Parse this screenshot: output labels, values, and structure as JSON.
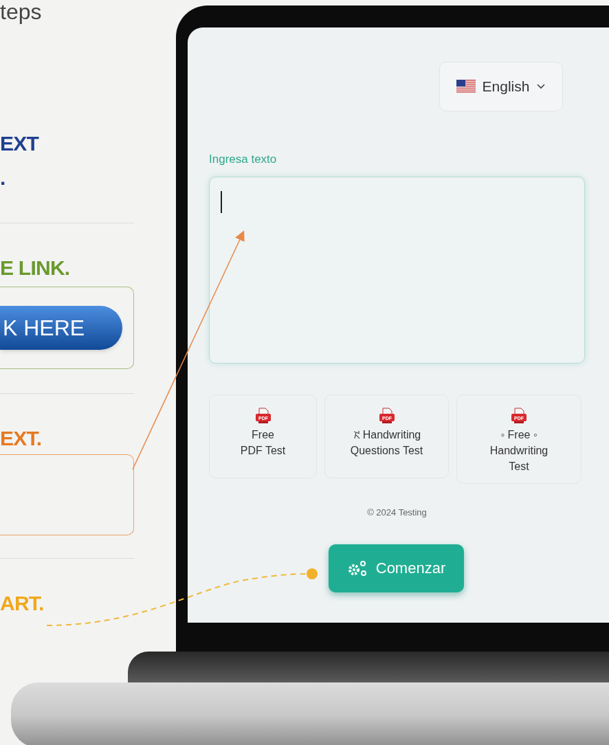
{
  "left_panel": {
    "heading": "teps",
    "steps": [
      {
        "kind": "plain",
        "lines": [
          "EXT",
          "."
        ],
        "color": "#1f3f8f"
      },
      {
        "kind": "button",
        "lines": [
          "E LINK."
        ],
        "color": "#6a9a2e",
        "button": "K HERE"
      },
      {
        "kind": "field",
        "lines": [
          "EXT."
        ],
        "color": "#e57a22"
      },
      {
        "kind": "plain",
        "lines": [
          "ART."
        ],
        "color": "#f0a81c"
      }
    ]
  },
  "screen": {
    "language": {
      "label": "English"
    },
    "input": {
      "label": "Ingresa texto",
      "focused": true
    },
    "cards": [
      {
        "icon_label": "PDF",
        "lines": [
          "Free",
          "PDF Test"
        ],
        "prefix_icon": false
      },
      {
        "icon_label": "PDF",
        "lines": [
          "Handwriting",
          "Questions Test"
        ],
        "prefix_icon": true
      },
      {
        "icon_label": "PDF",
        "lines": [
          "◦ Free ◦",
          "Handwriting",
          "Test"
        ],
        "prefix_icon": false
      }
    ],
    "footer": "© 2024 Testing",
    "start_button": "Comenzar"
  }
}
